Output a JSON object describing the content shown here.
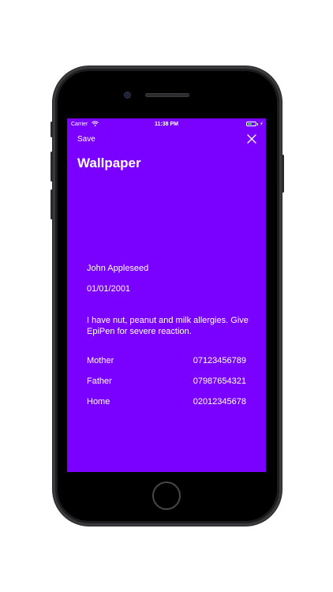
{
  "status_bar": {
    "carrier": "Carrier",
    "time": "11:38 PM",
    "wifi_icon": "wifi-icon",
    "battery_icon": "battery-icon",
    "charging_icon": "charging-bolt-icon"
  },
  "nav": {
    "save_label": "Save",
    "close_icon": "close-icon",
    "title": "Wallpaper"
  },
  "profile": {
    "name": "John Appleseed",
    "dob": "01/01/2001",
    "note": "I have nut, peanut and milk allergies. Give EpiPen for severe reaction."
  },
  "contacts": [
    {
      "label": "Mother",
      "phone": "07123456789"
    },
    {
      "label": "Father",
      "phone": "07987654321"
    },
    {
      "label": "Home",
      "phone": "02012345678"
    }
  ],
  "colors": {
    "screen_background": "#7a00ff",
    "text": "#ffffff",
    "device_frame": "#1c1c1e"
  }
}
